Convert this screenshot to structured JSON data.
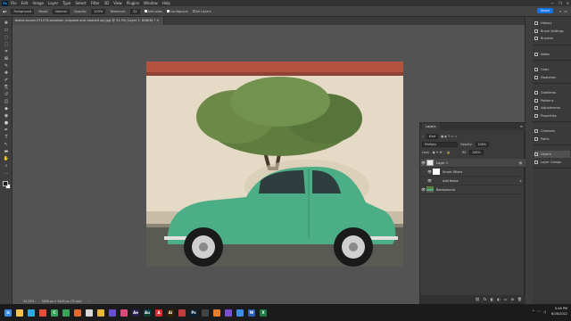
{
  "app": {
    "logo": "Ps",
    "menu": [
      "File",
      "Edit",
      "Image",
      "Layer",
      "Type",
      "Select",
      "Filter",
      "3D",
      "View",
      "Plugins",
      "Window",
      "Help"
    ],
    "window_controls": [
      "—",
      "❐",
      "✕"
    ]
  },
  "options_bar": {
    "tool_preset": "Foreground",
    "mode_label": "Mode:",
    "mode_value": "Normal",
    "opacity_label": "Opacity:",
    "opacity_value": "100%",
    "tolerance_label": "Tolerance:",
    "tolerance_value": "32",
    "anti_alias": "Anti-alias",
    "contiguous": "Contiguous",
    "all_layers": "All Layers",
    "share_label": "Share"
  },
  "document": {
    "tab_title": "blaise-souzer-971578-unsplash (cropped and cleaned up).jpg @ 33.3% (Layer 1, RGB/8) *",
    "zoom": "33.33%",
    "doc_size": "5050 px x 3443 px (72 ppi)"
  },
  "tools": [
    "move-tool-icon",
    "artboard-tool-icon",
    "lasso-tool-icon",
    "object-select-tool-icon",
    "crop-tool-icon",
    "frame-tool-icon",
    "eyedropper-tool-icon",
    "healing-brush-icon",
    "brush-tool-icon",
    "clone-stamp-icon",
    "history-brush-icon",
    "eraser-tool-icon",
    "paint-bucket-icon",
    "blur-tool-icon",
    "dodge-tool-icon",
    "pen-tool-icon",
    "type-tool-icon",
    "path-select-icon",
    "rectangle-tool-icon",
    "hand-tool-icon",
    "zoom-tool-icon",
    "more-tools-icon"
  ],
  "tool_glyphs": [
    "✥",
    "▭",
    "◌",
    "⬚",
    "⌗",
    "⊠",
    "✎",
    "✚",
    "✐",
    "⎘",
    "↺",
    "◫",
    "◆",
    "◉",
    "●",
    "✒",
    "T",
    "↖",
    "▬",
    "✋",
    "⌕",
    "…"
  ],
  "dock": {
    "group1": [
      "History",
      "Brush Settings",
      "Brushes"
    ],
    "group2": [
      "Notes"
    ],
    "group3": [
      "Color",
      "Swatches"
    ],
    "group4": [
      "Gradients",
      "Patterns",
      "Adjustments",
      "Properties"
    ],
    "group5": [
      "Channels",
      "Paths"
    ],
    "group6": [
      "Layers",
      "Layer Comps"
    ]
  },
  "layers_panel": {
    "tab": "Layers",
    "filter_kind": "Kind",
    "blend_mode": "Multiply",
    "opacity_label": "Opacity:",
    "opacity_value": "100%",
    "lock_label": "Lock:",
    "fill_label": "Fill:",
    "fill_value": "100%",
    "layers": [
      {
        "name": "Layer 1",
        "visible": true,
        "selected": true
      },
      {
        "name": "Smart Filters",
        "visible": true,
        "selected": false
      },
      {
        "name": "Add Noise",
        "visible": true,
        "selected": false
      },
      {
        "name": "Background",
        "visible": true,
        "selected": false
      }
    ],
    "footer_icons": [
      "link-icon",
      "fx-icon",
      "mask-icon",
      "adjustment-icon",
      "group-icon",
      "new-layer-icon",
      "trash-icon"
    ]
  },
  "taskbar": {
    "time": "5:46 PM",
    "date": "6/28/2022",
    "apps": [
      {
        "name": "start-icon",
        "color": "#3a8ee6",
        "glyph": "⊞"
      },
      {
        "name": "file-explorer-icon",
        "color": "#f2c14e",
        "glyph": ""
      },
      {
        "name": "edge-icon",
        "color": "#2fa8e0",
        "glyph": ""
      },
      {
        "name": "app-icon",
        "color": "#e84e3c",
        "glyph": ""
      },
      {
        "name": "camtasia-icon",
        "color": "#3aa35a",
        "glyph": "C"
      },
      {
        "name": "app-icon",
        "color": "#3aa35a",
        "glyph": ""
      },
      {
        "name": "app-icon",
        "color": "#e06b2f",
        "glyph": ""
      },
      {
        "name": "app-icon",
        "color": "#d9d9d9",
        "glyph": ""
      },
      {
        "name": "chrome-icon",
        "color": "#e8b634",
        "glyph": ""
      },
      {
        "name": "app-icon",
        "color": "#6b4fd1",
        "glyph": ""
      },
      {
        "name": "app-icon",
        "color": "#d94b7b",
        "glyph": ""
      },
      {
        "name": "after-effects-icon",
        "color": "#2a1f4f",
        "glyph": "Ae"
      },
      {
        "name": "audition-icon",
        "color": "#0b3b3b",
        "glyph": "Au"
      },
      {
        "name": "acrobat-icon",
        "color": "#d62e2e",
        "glyph": "A"
      },
      {
        "name": "illustrator-icon",
        "color": "#3a2200",
        "glyph": "Ai"
      },
      {
        "name": "app-icon",
        "color": "#c23d3d",
        "glyph": ""
      },
      {
        "name": "photoshop-icon",
        "color": "#0b2236",
        "glyph": "Ps"
      },
      {
        "name": "app-icon",
        "color": "#444444",
        "glyph": ""
      },
      {
        "name": "app-icon",
        "color": "#e87e2b",
        "glyph": ""
      },
      {
        "name": "app-icon",
        "color": "#7a4fd1",
        "glyph": ""
      },
      {
        "name": "app-icon",
        "color": "#3a8ee6",
        "glyph": ""
      },
      {
        "name": "word-icon",
        "color": "#2b5fb3",
        "glyph": "W"
      },
      {
        "name": "excel-icon",
        "color": "#1f7a44",
        "glyph": "X"
      }
    ]
  },
  "colors": {
    "accent": "#1473e6",
    "car": "#4cae86",
    "selection": "#474747"
  }
}
